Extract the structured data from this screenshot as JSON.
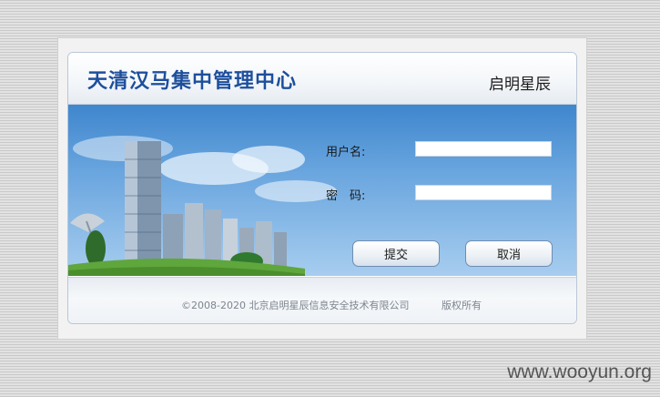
{
  "header": {
    "title": "天清汉马集中管理中心",
    "brand": "启明星辰"
  },
  "login": {
    "username_label": "用户名:",
    "username_value": "",
    "password_label": "密　码:",
    "password_value": "",
    "submit_label": "提交",
    "cancel_label": "取消"
  },
  "footer": {
    "copyright": "©2008-2020  北京启明星辰信息安全技术有限公司",
    "rights": "版权所有"
  },
  "watermark": "www.wooyun.org",
  "colors": {
    "title": "#1d4f9c",
    "banner_top": "#3f86cd",
    "banner_bottom": "#a7cdef"
  }
}
